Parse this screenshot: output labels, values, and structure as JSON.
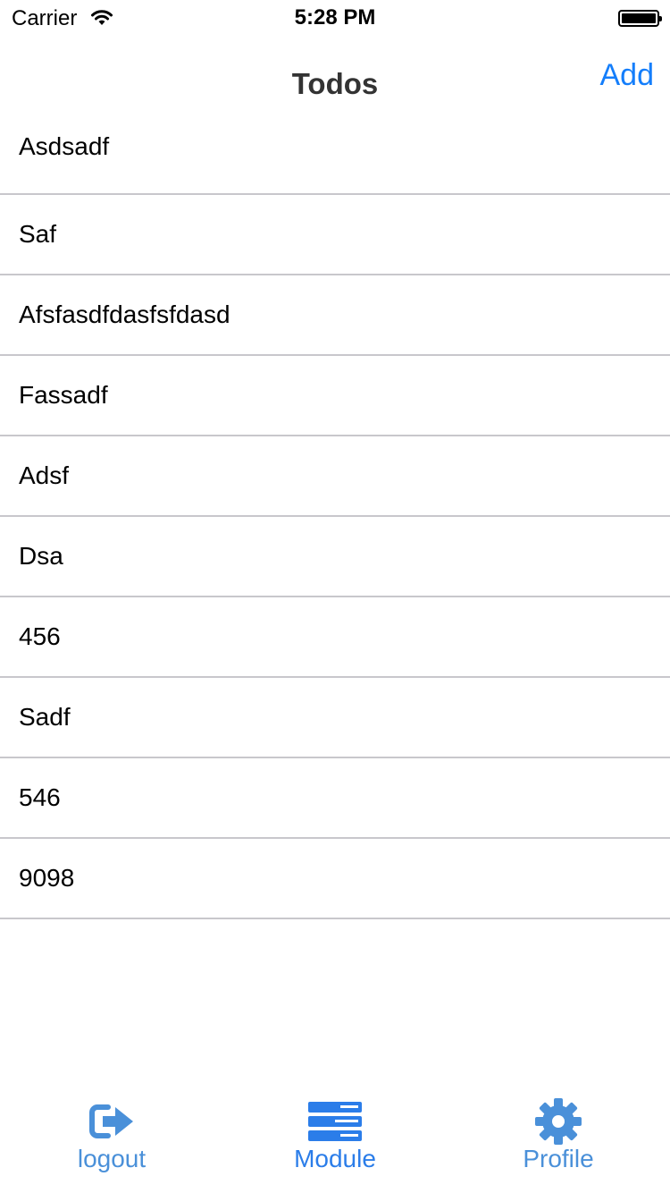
{
  "status_bar": {
    "carrier": "Carrier",
    "time": "5:28 PM"
  },
  "nav": {
    "title": "Todos",
    "add_label": "Add"
  },
  "todos": [
    {
      "label": "Asdsadf"
    },
    {
      "label": "Saf"
    },
    {
      "label": "Afsfasdfdasfsfdasd"
    },
    {
      "label": "Fassadf"
    },
    {
      "label": "Adsf"
    },
    {
      "label": "Dsa"
    },
    {
      "label": "456"
    },
    {
      "label": "Sadf"
    },
    {
      "label": "546"
    },
    {
      "label": "9098"
    }
  ],
  "tab_bar": {
    "items": [
      {
        "label": "logout",
        "icon": "logout-icon"
      },
      {
        "label": "Module",
        "icon": "module-icon"
      },
      {
        "label": "Profile",
        "icon": "gear-icon"
      }
    ]
  },
  "colors": {
    "accent": "#147efb",
    "tab_icon": "#4a90d9",
    "separator": "#c8c7cc"
  }
}
